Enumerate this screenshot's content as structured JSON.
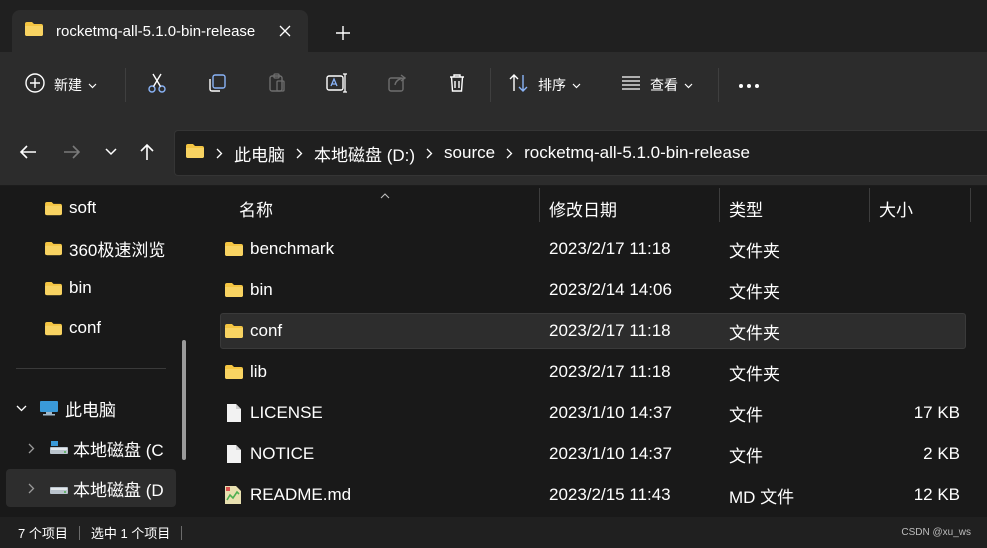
{
  "colors": {
    "folder": "#f4c542",
    "background": "#191919",
    "toolbar": "#2c2c2c",
    "selection": "#2d2d2d",
    "pc_icon": "#3a9ad9"
  },
  "tab": {
    "title": "rocketmq-all-5.1.0-bin-release",
    "icon": "folder-icon"
  },
  "toolbar": {
    "new_label": "新建",
    "sort_label": "排序",
    "view_label": "查看"
  },
  "address": {
    "crumbs": [
      "此电脑",
      "本地磁盘 (D:)",
      "source",
      "rocketmq-all-5.1.0-bin-release"
    ]
  },
  "nav": {
    "items": [
      {
        "label": "soft",
        "icon": "folder-icon"
      },
      {
        "label": "360极速浏览",
        "icon": "folder-icon"
      },
      {
        "label": "bin",
        "icon": "folder-icon"
      },
      {
        "label": "conf",
        "icon": "folder-icon"
      },
      {
        "label": "此电脑",
        "icon": "pc-icon"
      },
      {
        "label": "本地磁盘 (C",
        "icon": "drive-icon"
      },
      {
        "label": "本地磁盘 (D",
        "icon": "drive-icon"
      }
    ]
  },
  "columns": {
    "name": "名称",
    "date": "修改日期",
    "type": "类型",
    "size": "大小"
  },
  "files": [
    {
      "name": "benchmark",
      "date": "2023/2/17 11:18",
      "type": "文件夹",
      "size": "",
      "icon": "folder-icon"
    },
    {
      "name": "bin",
      "date": "2023/2/14 14:06",
      "type": "文件夹",
      "size": "",
      "icon": "folder-icon"
    },
    {
      "name": "conf",
      "date": "2023/2/17 11:18",
      "type": "文件夹",
      "size": "",
      "icon": "folder-icon",
      "selected": true
    },
    {
      "name": "lib",
      "date": "2023/2/17 11:18",
      "type": "文件夹",
      "size": "",
      "icon": "folder-icon"
    },
    {
      "name": "LICENSE",
      "date": "2023/1/10 14:37",
      "type": "文件",
      "size": "17 KB",
      "icon": "file-icon"
    },
    {
      "name": "NOTICE",
      "date": "2023/1/10 14:37",
      "type": "文件",
      "size": "2 KB",
      "icon": "file-icon"
    },
    {
      "name": "README.md",
      "date": "2023/2/15 11:43",
      "type": "MD 文件",
      "size": "12 KB",
      "icon": "markdown-file-icon"
    }
  ],
  "status": {
    "count": "7 个项目",
    "selected": "选中 1 个项目"
  },
  "watermark": "CSDN @xu_ws"
}
